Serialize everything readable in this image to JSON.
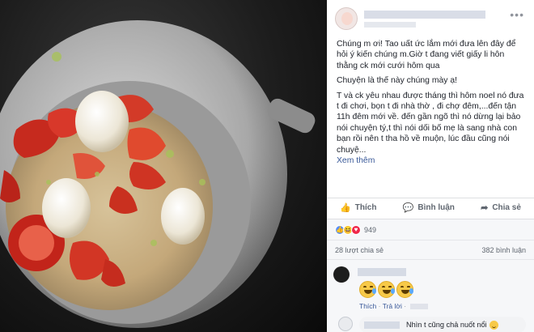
{
  "post": {
    "paragraph1": "Chúng m ơi! Tao uất ức lắm mới đưa lên đây để hỏi ý kiến chúng m.Giờ t đang viết giấy li hôn thằng ck mới cưới hôm qua",
    "paragraph2": "Chuyện là thế này chúng mày ạ!",
    "paragraph3": "T và ck yêu nhau được tháng thì hôm noel nó đưa t đi chơi, bọn t đi nhà thờ , đi chợ đêm,...đến tận 11h đêm mới về. đến gần ngõ thì nó dừng lại bảo nói chuyện tý,t thì nói dối bố mẹ là sang nhà con bạn rồi nên t tha hồ về muộn, lúc đầu cũng nói chuyệ...",
    "see_more": "Xem thêm"
  },
  "actions": {
    "like": "Thích",
    "comment": "Bình luận",
    "share": "Chia sẻ"
  },
  "reactions": {
    "count": "949",
    "icons": [
      "like-icon",
      "haha-icon",
      "love-icon"
    ]
  },
  "counts": {
    "shares": "28 lượt chia sẻ",
    "comments": "382 bình luận"
  },
  "comments": [
    {
      "actions": {
        "like": "Thích",
        "sep": "·",
        "reply": "Trả lời",
        "sep2": "·"
      }
    },
    {
      "text": "Nhìn t cũng chả nuốt nổi"
    }
  ],
  "colors": {
    "link": "#385898",
    "text": "#1d2129",
    "muted": "#606770",
    "like_blue": "#5890ff"
  }
}
